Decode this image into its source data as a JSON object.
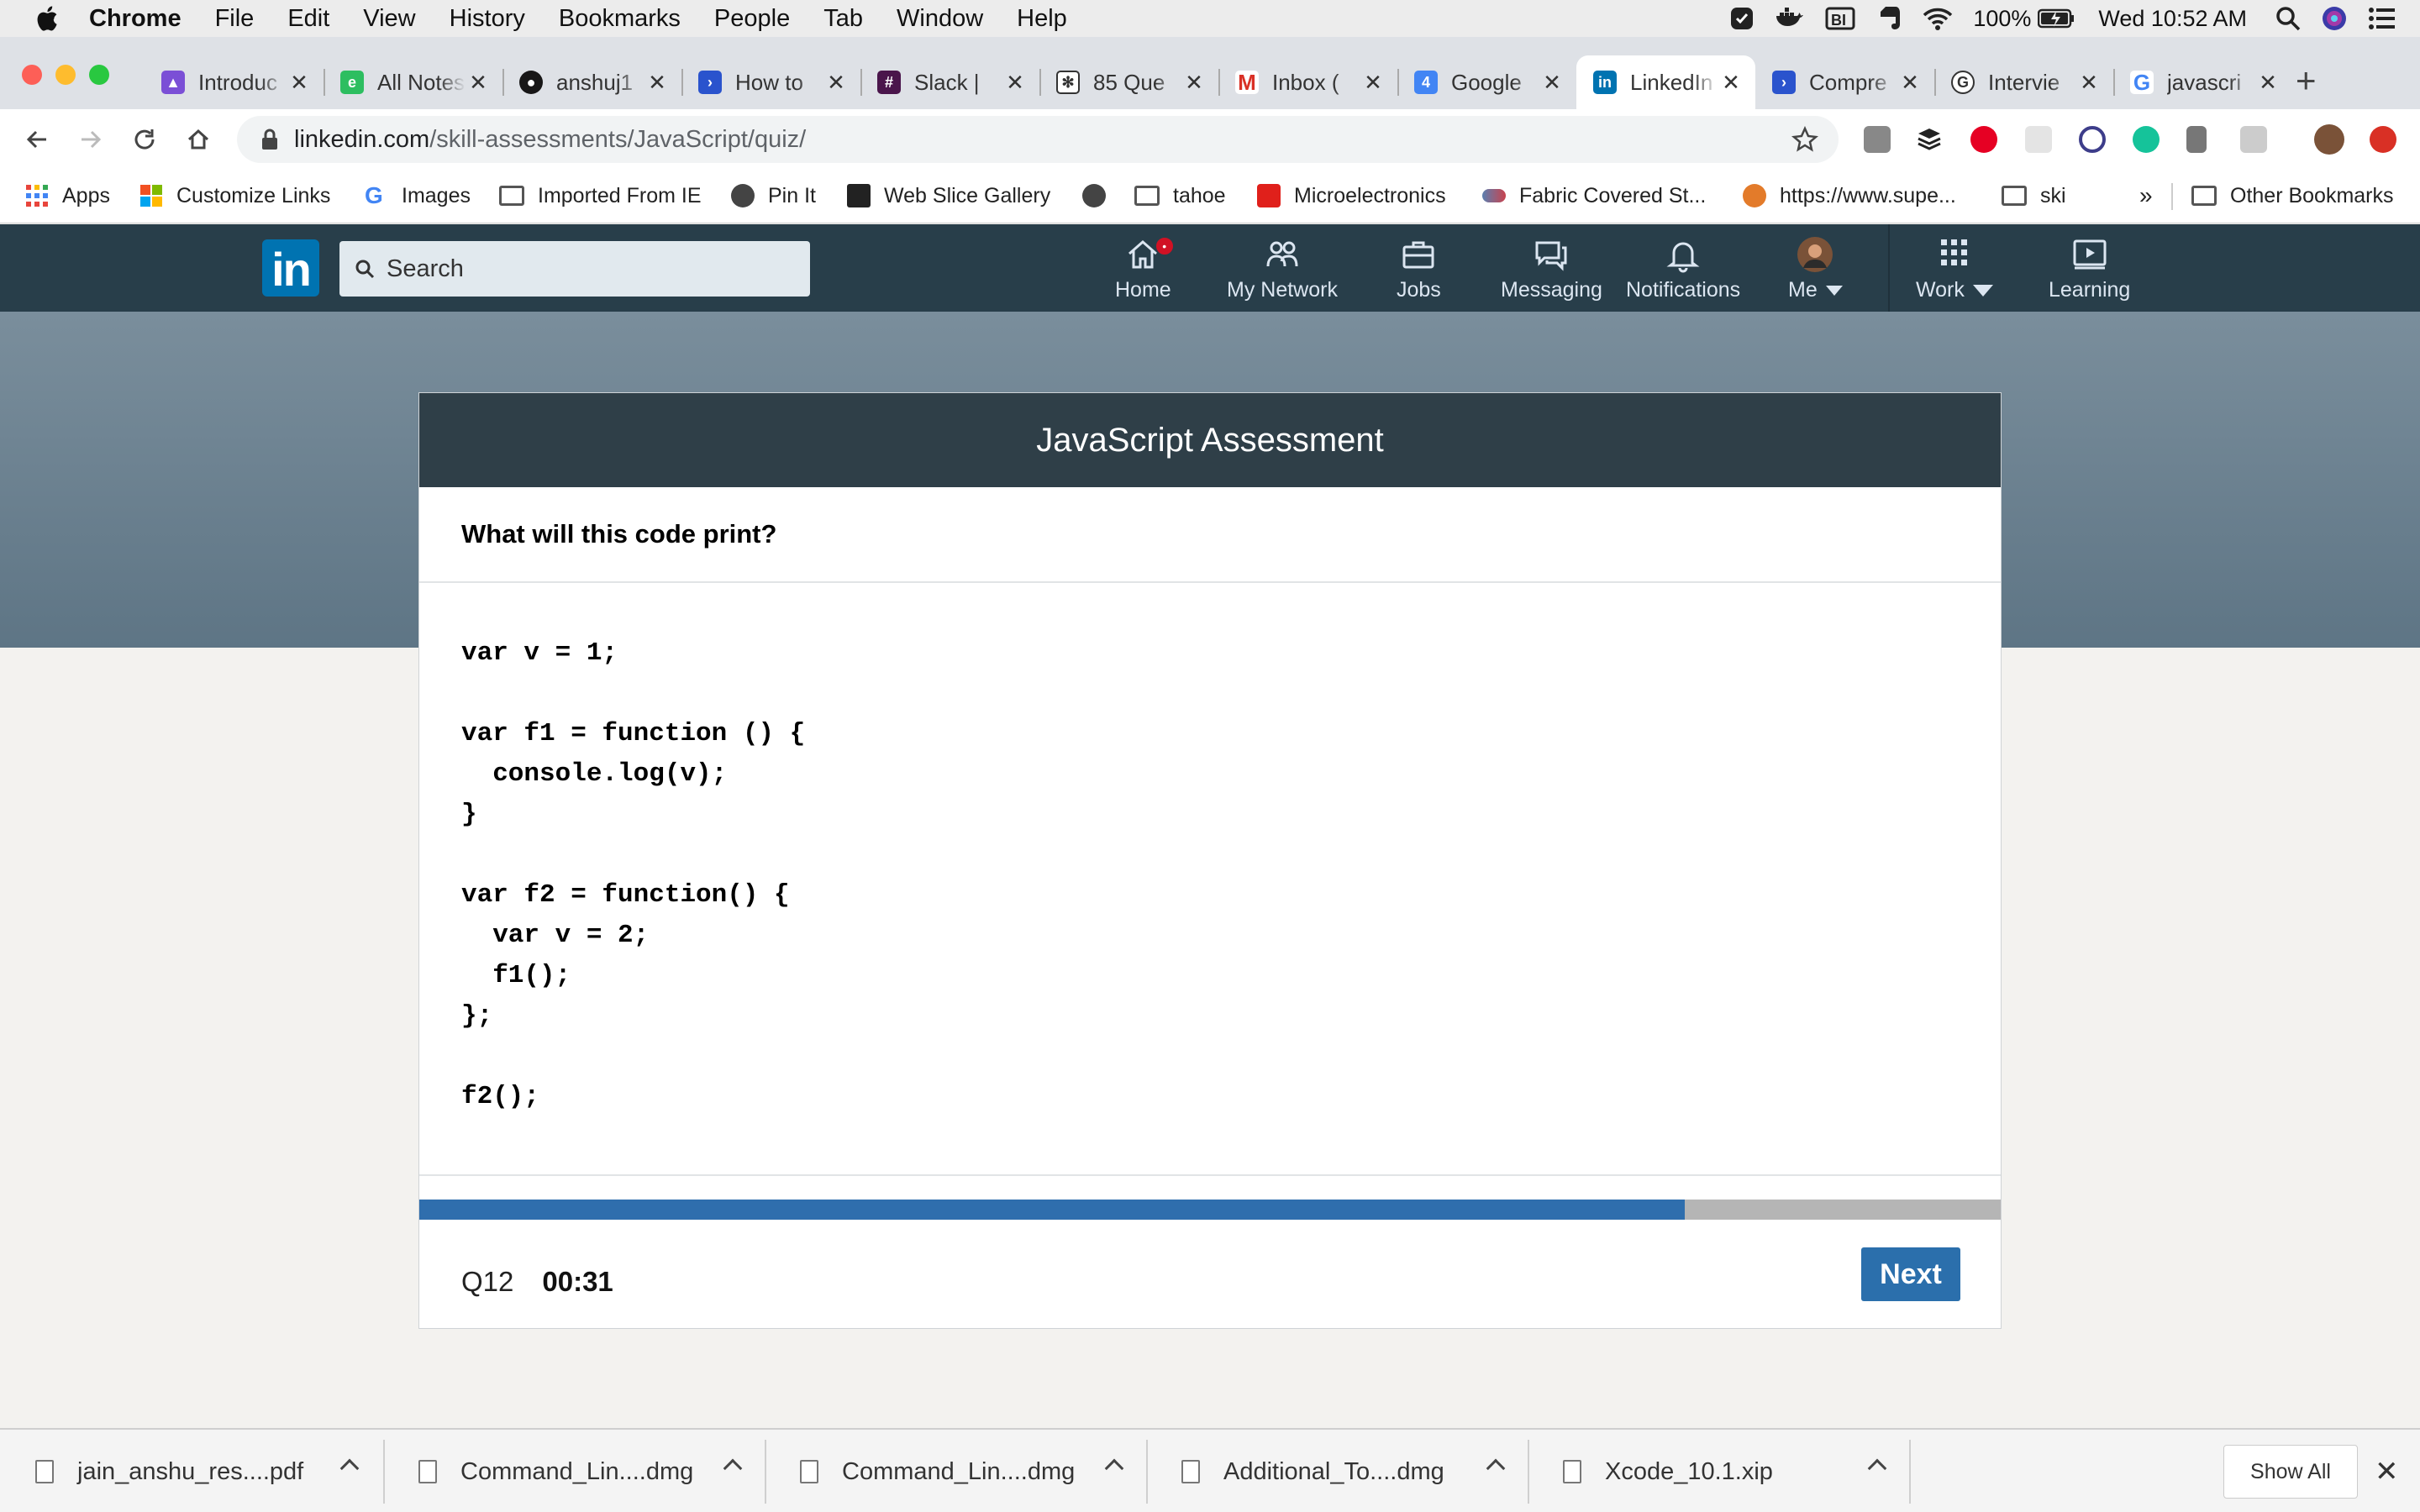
{
  "menubar": {
    "app": "Chrome",
    "items": [
      "File",
      "Edit",
      "View",
      "History",
      "Bookmarks",
      "People",
      "Tab",
      "Window",
      "Help"
    ],
    "battery": "100%",
    "clock": "Wed 10:52 AM"
  },
  "tabs": [
    {
      "title": "Introduc",
      "favicon_color": "#7b4fd6",
      "favicon": "rocket-icon"
    },
    {
      "title": "All Notes",
      "favicon_color": "#2dbe60",
      "favicon": "evernote-icon"
    },
    {
      "title": "anshuj1",
      "favicon_color": "#181717",
      "favicon": "github-icon"
    },
    {
      "title": "How to",
      "favicon_color": "#2a53cd",
      "favicon": "jira-icon"
    },
    {
      "title": "Slack |",
      "favicon_color": "#4a154b",
      "favicon": "slack-icon"
    },
    {
      "title": "85 Que",
      "favicon_color": "#333333",
      "favicon": "atom-icon"
    },
    {
      "title": "Inbox (",
      "favicon_color": "#d93025",
      "favicon": "gmail-icon"
    },
    {
      "title": "Google",
      "favicon_color": "#4285f4",
      "favicon": "calendar-icon"
    },
    {
      "title": "LinkedIn",
      "favicon_color": "#0073b1",
      "favicon": "linkedin-icon",
      "active": true
    },
    {
      "title": "Compre",
      "favicon_color": "#2a53cd",
      "favicon": "jira-icon"
    },
    {
      "title": "Intervie",
      "favicon_color": "#333333",
      "favicon": "glassdoor-icon"
    },
    {
      "title": "javascri",
      "favicon_color": "#4285f4",
      "favicon": "google-icon"
    }
  ],
  "omnibox": {
    "host": "linkedin.com",
    "path": "/skill-assessments/JavaScript/quiz/"
  },
  "bookmarks": [
    "Apps",
    "Customize Links",
    "Images",
    "Imported From IE",
    "Pin It",
    "Web Slice Gallery",
    "",
    "tahoe",
    "Microelectronics",
    "Fabric Covered St...",
    "https://www.supe...",
    "ski"
  ],
  "bookmarks_overflow": "»",
  "bookmarks_other": "Other Bookmarks",
  "linkedin": {
    "logo": "in",
    "search_placeholder": "Search",
    "nav": [
      {
        "label": "Home",
        "icon": "home-icon"
      },
      {
        "label": "My Network",
        "icon": "network-icon"
      },
      {
        "label": "Jobs",
        "icon": "briefcase-icon"
      },
      {
        "label": "Messaging",
        "icon": "messaging-icon"
      },
      {
        "label": "Notifications",
        "icon": "bell-icon"
      },
      {
        "label": "Me",
        "icon": "avatar"
      },
      {
        "label": "Work",
        "icon": "grid-icon"
      },
      {
        "label": "Learning",
        "icon": "learning-icon"
      }
    ]
  },
  "assessment": {
    "title": "JavaScript Assessment",
    "question": "What will this code print?",
    "code_lines": [
      "var v = 1;",
      "",
      "var f1 = function () {",
      "  console.log(v);",
      "}",
      "",
      "var f2 = function() {",
      "  var v = 2;",
      "  f1();",
      "};",
      "",
      "f2();"
    ],
    "progress_fraction": 0.8,
    "question_number": "Q12",
    "timer": "00:31",
    "next_label": "Next"
  },
  "downloads": [
    "jain_anshu_res....pdf",
    "Command_Lin....dmg",
    "Command_Lin....dmg",
    "Additional_To....dmg",
    "Xcode_10.1.xip"
  ],
  "downloads_show_all": "Show All",
  "colors": {
    "linkedin_nav": "#283e4a",
    "linkedin_blue": "#0073b1",
    "progress": "#2f6ead",
    "next_button": "#2b6fac"
  }
}
